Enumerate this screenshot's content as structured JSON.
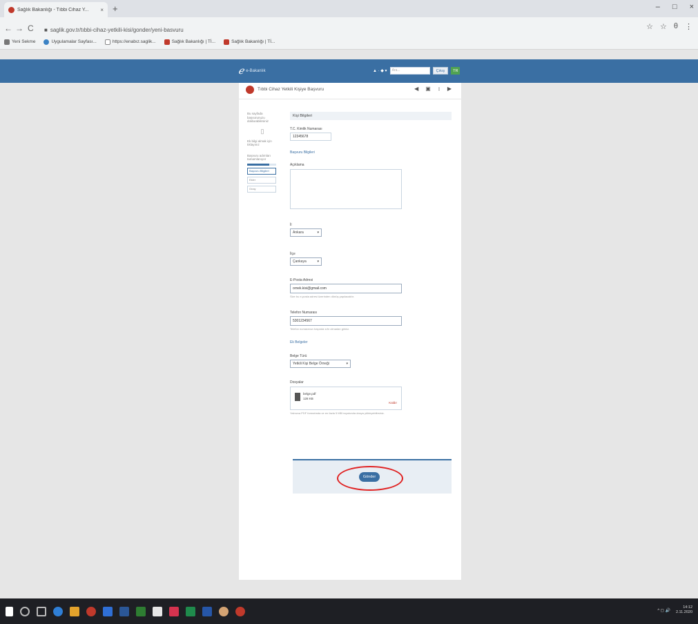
{
  "browser": {
    "tab_title": "Sağlık Bakanlığı - Tıbbi Cihaz Y...",
    "tab_close": "×",
    "new_tab": "+",
    "window_controls": [
      "–",
      "□",
      "×"
    ],
    "nav_back": "←",
    "nav_forward": "→",
    "reload": "C",
    "url": "saglik.gov.tr/tıbbi-cihaz-yetkili-kisi/gonder/yeni-basvuru",
    "toolbar_icons": [
      "☆",
      "☆",
      "θ",
      "⋮"
    ],
    "bookmarks": [
      "Yeni Sekme",
      "Uygulamalar Sayfası...",
      "https://enabız.saglik...",
      "Sağlık Bakanlığı | Tİ...",
      "Sağlık Bakanlığı | Tİ..."
    ]
  },
  "site_header": {
    "logo_mark": "ℯ",
    "logo_text": "e-Bakanlık",
    "user_short": "▲ · ◆ ▾",
    "search_placeholder": "Ara...",
    "button_label": "Çıkış",
    "tag_label": "TR"
  },
  "card": {
    "title": "Tıbbi Cihaz Yetkili Kişiye Başvuru",
    "actions": [
      "◀",
      "▣",
      "↕",
      "▶"
    ]
  },
  "sidebar": {
    "intro": "Bu sayfada başvurunuzu doldurabilirsiniz",
    "info": "Ek bilgi almak için tıklayınız",
    "progress_text": "Başvuru adımları tamamlanıyor",
    "progress_fraction": 0.75,
    "steps": [
      "Başvuru Bilgileri",
      "Ekler",
      "Onay"
    ]
  },
  "form": {
    "section_title": "Kişi Bilgileri",
    "id_label": "T.C. Kimlik Numarası",
    "id_value": "12345678",
    "link_1": "Başvuru Bilgileri",
    "notes_label": "Açıklama",
    "select1_label": "İl",
    "select1_value": "Ankara",
    "select2_label": "İlçe",
    "select2_value": "Çankaya",
    "email_label": "E-Posta Adresi",
    "email_value": "ornek.kisi@gmail.com",
    "email_hint": "Size bu e-posta adresi üzerinden dönüş yapılacaktır.",
    "phone_label": "Telefon Numarası",
    "phone_value": "5301234567",
    "phone_hint": "Telefon numaranızı başında sıfır olmadan giriniz.",
    "link_2": "Ek Belgeler",
    "doc_type_label": "Belge Türü",
    "doc_type_value": "Yetkili Kişi Belge Örneği",
    "attach_label": "Dosyalar",
    "file_name": "belge.pdf",
    "file_size": "128 KB",
    "file_remove": "Kaldır",
    "attach_hint": "Yalnızca PDF formatında ve en fazla 5 MB boyutunda dosya yükleyebilirsiniz.",
    "submit_label": "Gönder"
  },
  "taskbar": {
    "time": "14:12",
    "date": "2.11.2020",
    "tray_icons": "^ ◻ 🔊"
  },
  "colors": {
    "header_blue": "#3a6fa3",
    "highlight_red": "#e02020"
  }
}
